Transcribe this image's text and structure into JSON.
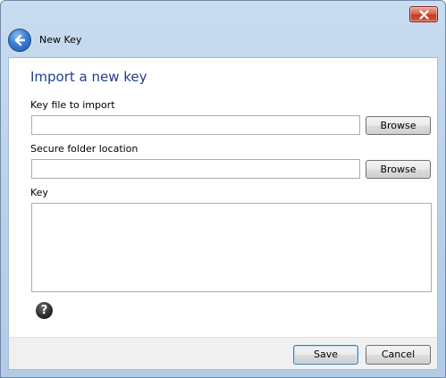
{
  "window": {
    "title": "New Key"
  },
  "content": {
    "heading": "Import a new key",
    "key_file": {
      "label": "Key file to import",
      "value": "",
      "browse_label": "Browse"
    },
    "secure_folder": {
      "label": "Secure folder location",
      "value": "",
      "browse_label": "Browse"
    },
    "key": {
      "label": "Key",
      "value": ""
    }
  },
  "footer": {
    "save_label": "Save",
    "cancel_label": "Cancel"
  },
  "icons": {
    "close": "close-icon",
    "back": "back-arrow-icon",
    "help": "help-icon"
  },
  "colors": {
    "heading": "#1e3f8e",
    "close_button": "#c23a22",
    "back_button": "#3a7fd1",
    "frame": "#b9d0ea"
  }
}
